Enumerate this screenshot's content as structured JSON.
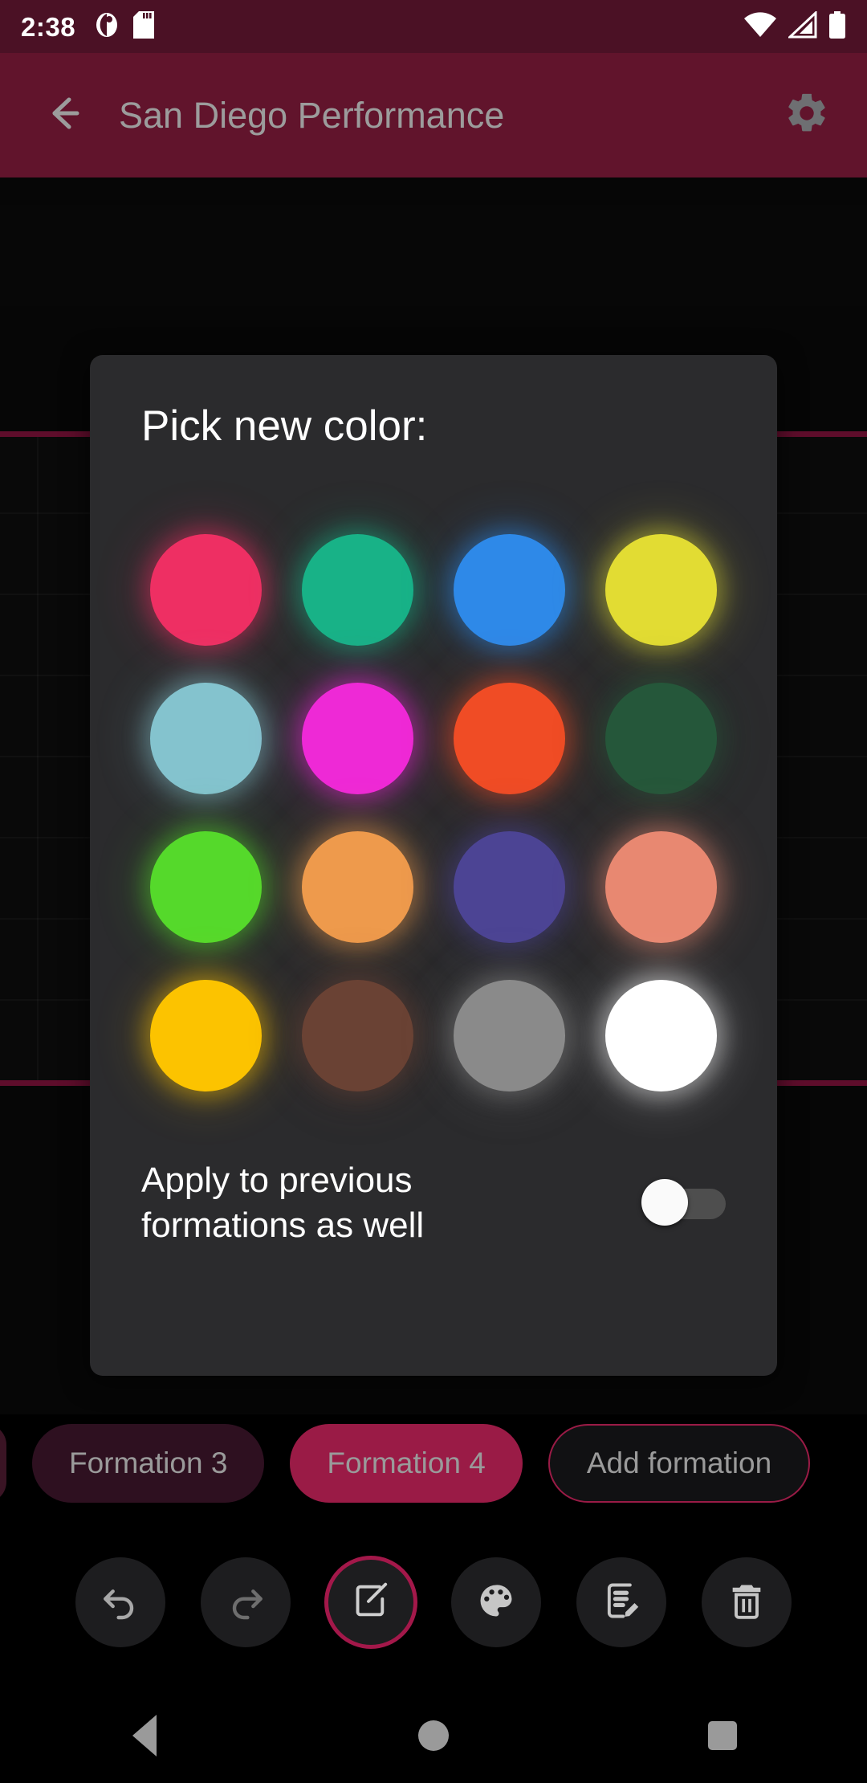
{
  "status_bar": {
    "time": "2:38",
    "icons": [
      "app-notification-icon",
      "sd-card-icon",
      "wifi-icon",
      "cellular-signal-icon",
      "battery-icon"
    ],
    "background": "#4B1125"
  },
  "app_bar": {
    "back_icon": "arrow-left-icon",
    "title": "San Diego Performance",
    "settings_icon": "gear-icon",
    "background": "#8C1D40",
    "title_color": "#9C9C9C"
  },
  "dialog": {
    "title": "Pick new color:",
    "background": "#2B2B2D",
    "swatches": [
      {
        "name": "pink",
        "hex": "#EE2F63"
      },
      {
        "name": "teal-green",
        "hex": "#18B287"
      },
      {
        "name": "blue",
        "hex": "#2E89E8"
      },
      {
        "name": "yellow",
        "hex": "#E2DC33"
      },
      {
        "name": "light-blue",
        "hex": "#84C3CE"
      },
      {
        "name": "magenta",
        "hex": "#EE29D6"
      },
      {
        "name": "orange-red",
        "hex": "#F04C25"
      },
      {
        "name": "dark-green",
        "hex": "#25573A"
      },
      {
        "name": "bright-green",
        "hex": "#55D92B"
      },
      {
        "name": "orange",
        "hex": "#EE9A4C"
      },
      {
        "name": "indigo",
        "hex": "#4C4494"
      },
      {
        "name": "salmon",
        "hex": "#E88871"
      },
      {
        "name": "gold",
        "hex": "#FCC300"
      },
      {
        "name": "brown",
        "hex": "#6A4234"
      },
      {
        "name": "gray",
        "hex": "#8A8A8A"
      },
      {
        "name": "white",
        "hex": "#FFFFFF"
      }
    ],
    "apply_label": "Apply to previous formations as well",
    "apply_toggle_state": "off"
  },
  "formations": {
    "chips": [
      {
        "label": "",
        "state": "partial"
      },
      {
        "label": "Formation 3",
        "state": "inactive"
      },
      {
        "label": "Formation 4",
        "state": "active"
      },
      {
        "label": "Add formation",
        "state": "outline"
      }
    ],
    "active_color": "#9A1B46",
    "inactive_color": "#2E1020"
  },
  "toolbar": {
    "buttons": [
      {
        "name": "undo-icon",
        "label": "Undo",
        "highlighted": false
      },
      {
        "name": "redo-icon",
        "label": "Redo",
        "highlighted": false
      },
      {
        "name": "draw-edit-icon",
        "label": "Draw",
        "highlighted": true
      },
      {
        "name": "palette-icon",
        "label": "Color",
        "highlighted": false
      },
      {
        "name": "notes-edit-icon",
        "label": "Notes",
        "highlighted": false
      },
      {
        "name": "trash-icon",
        "label": "Delete",
        "highlighted": false
      }
    ],
    "highlight_color": "#A3184A"
  },
  "nav_bar": {
    "back": "back-triangle-icon",
    "home": "home-circle-icon",
    "recents": "recents-square-icon"
  }
}
